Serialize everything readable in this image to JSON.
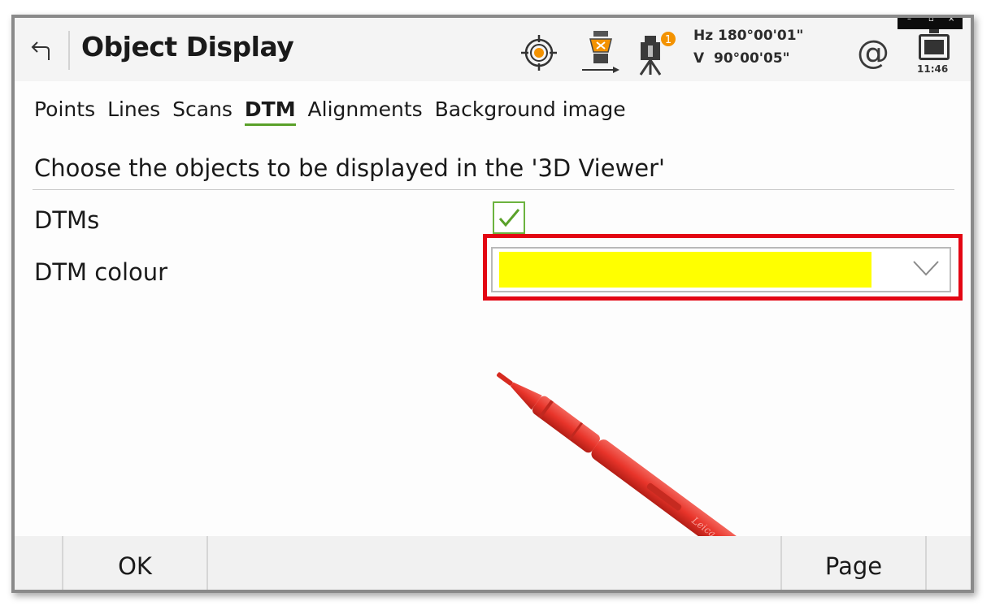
{
  "header": {
    "title": "Object Display",
    "hz": "Hz 180°00'01\"",
    "v": "V  90°00'05\"",
    "badge_count": "1",
    "at_symbol": "@",
    "time": "11:46",
    "window_controls": [
      "–",
      "▫",
      "×"
    ]
  },
  "tabs": [
    {
      "label": "Points"
    },
    {
      "label": "Lines"
    },
    {
      "label": "Scans"
    },
    {
      "label": "DTM"
    },
    {
      "label": "Alignments"
    },
    {
      "label": "Background image"
    }
  ],
  "active_tab": "DTM",
  "instruction": "Choose the objects to be displayed in the '3D Viewer'",
  "fields": {
    "dtms": {
      "label": "DTMs",
      "checked": true
    },
    "dtm_colour": {
      "label": "DTM colour",
      "value_color": "#ffff00"
    }
  },
  "softkeys": {
    "ok": "OK",
    "page": "Page"
  },
  "icons": {
    "back": "back-arrow-icon",
    "target": "target-icon",
    "prism": "prism-icon",
    "instrument": "instrument-icon",
    "battery": "battery-icon",
    "dropdown": "chevron-down-icon"
  },
  "colors": {
    "accent_green": "#5aa12a",
    "highlight_red": "#e30613",
    "badge_orange": "#f39200",
    "pen_red": "#e8342a"
  }
}
